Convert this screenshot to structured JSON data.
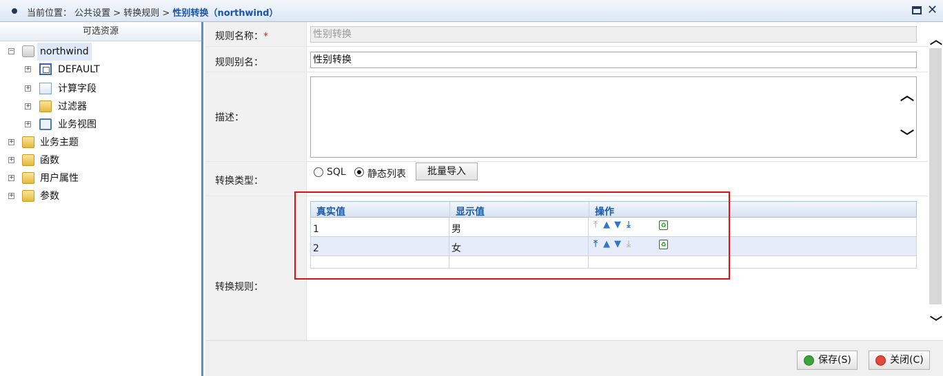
{
  "header": {
    "prefix": "当前位置： 公共设置 > 转换规则 > ",
    "current": "性别转换（northwind）"
  },
  "sidebar": {
    "title": "可选资源",
    "tree": [
      {
        "label": "northwind",
        "icon": "database-icon",
        "expanded": true,
        "selected": true
      },
      {
        "label": "DEFAULT",
        "icon": "table-icon"
      },
      {
        "label": "计算字段",
        "icon": "calc-field-icon"
      },
      {
        "label": "过滤器",
        "icon": "filter-icon"
      },
      {
        "label": "业务视图",
        "icon": "view-icon"
      },
      {
        "label": "业务主题",
        "icon": "folder-icon"
      },
      {
        "label": "函数",
        "icon": "function-icon"
      },
      {
        "label": "用户属性",
        "icon": "user-attr-icon"
      },
      {
        "label": "参数",
        "icon": "param-icon"
      }
    ]
  },
  "form": {
    "rule_name_label": "规则名称：",
    "required_mark": "*",
    "rule_name_value": "性别转换",
    "alias_label": "规则别名：",
    "alias_value": "性别转换",
    "desc_label": "描述：",
    "desc_value": "",
    "type_label": "转换类型：",
    "type_options": [
      "SQL",
      "静态列表"
    ],
    "type_selected": "静态列表",
    "import_button": "批量导入",
    "rules_label": "转换规则："
  },
  "grid": {
    "columns": [
      "真实值",
      "显示值",
      "操作"
    ],
    "rows": [
      {
        "real": "1",
        "display": "男"
      },
      {
        "real": "2",
        "display": "女"
      },
      {
        "real": "",
        "display": ""
      }
    ]
  },
  "footer": {
    "save": "保存(S)",
    "close": "关闭(C)"
  },
  "colors": {
    "accent": "#1a53a8",
    "highlight_box": "#e01010",
    "selected_row": "#e6ecf9"
  }
}
